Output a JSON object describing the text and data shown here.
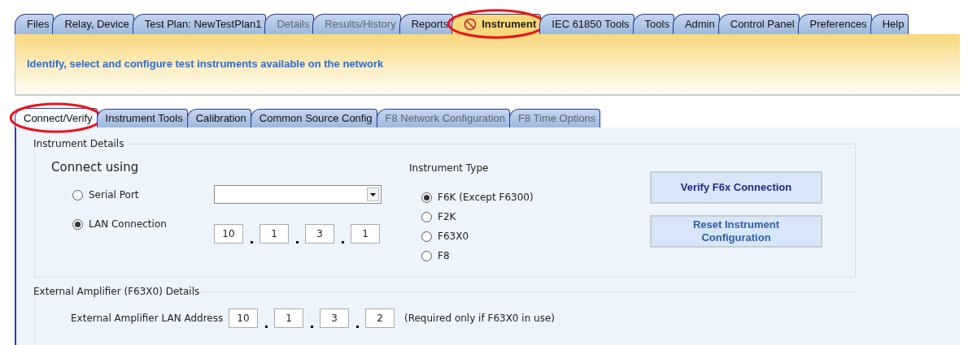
{
  "top_tabs": [
    {
      "label": "Files",
      "selected": false,
      "disabled": false,
      "circled": false,
      "blocked": false
    },
    {
      "label": "Relay, Device",
      "selected": false,
      "disabled": false,
      "circled": false,
      "blocked": false
    },
    {
      "label": "Test Plan: NewTestPlan1",
      "selected": false,
      "disabled": false,
      "circled": false,
      "blocked": false
    },
    {
      "label": "Details",
      "selected": false,
      "disabled": true,
      "circled": false,
      "blocked": false
    },
    {
      "label": "Results/History",
      "selected": false,
      "disabled": true,
      "circled": false,
      "blocked": false
    },
    {
      "label": "Reports",
      "selected": false,
      "disabled": false,
      "circled": false,
      "blocked": false
    },
    {
      "label": "Instrument",
      "selected": true,
      "disabled": false,
      "circled": true,
      "blocked": true
    },
    {
      "label": "IEC 61850 Tools",
      "selected": false,
      "disabled": false,
      "circled": false,
      "blocked": false
    },
    {
      "label": "Tools",
      "selected": false,
      "disabled": false,
      "circled": false,
      "blocked": false
    },
    {
      "label": "Admin",
      "selected": false,
      "disabled": false,
      "circled": false,
      "blocked": false
    },
    {
      "label": "Control Panel",
      "selected": false,
      "disabled": false,
      "circled": false,
      "blocked": false
    },
    {
      "label": "Preferences",
      "selected": false,
      "disabled": false,
      "circled": false,
      "blocked": false
    },
    {
      "label": "Help",
      "selected": false,
      "disabled": false,
      "circled": false,
      "blocked": false
    }
  ],
  "banner": {
    "text": "Identify, select and configure test instruments available on the network"
  },
  "sub_tabs": [
    {
      "label": "Connect/Verify",
      "selected": true,
      "disabled": false,
      "circled": true
    },
    {
      "label": "Instrument Tools",
      "selected": false,
      "disabled": false,
      "circled": false
    },
    {
      "label": "Calibration",
      "selected": false,
      "disabled": false,
      "circled": false
    },
    {
      "label": "Common Source Config",
      "selected": false,
      "disabled": false,
      "circled": false
    },
    {
      "label": "F8 Network Configuration",
      "selected": false,
      "disabled": true,
      "circled": false
    },
    {
      "label": "F8 Time Options",
      "selected": false,
      "disabled": true,
      "circled": false
    }
  ],
  "instrument_details": {
    "legend": "Instrument Details",
    "connect_label": "Connect using",
    "connection_options": [
      {
        "label": "Serial Port",
        "selected": false,
        "kind": "dropdown"
      },
      {
        "label": "LAN Connection",
        "selected": true,
        "kind": "ip",
        "octets": [
          "10",
          "1",
          "3",
          "1"
        ]
      }
    ],
    "instrument_type": {
      "label": "Instrument Type",
      "options": [
        {
          "label": "F6K (Except F6300)",
          "selected": true
        },
        {
          "label": "F2K",
          "selected": false
        },
        {
          "label": "F63X0",
          "selected": false
        },
        {
          "label": "F8",
          "selected": false
        }
      ]
    },
    "buttons": [
      {
        "label": "Verify F6x Connection",
        "kind": "primary"
      },
      {
        "label": "Reset Instrument Configuration",
        "kind": "secondary"
      }
    ]
  },
  "external_amplifier": {
    "legend": "External Amplifier (F63X0) Details",
    "label": "External Amplifier LAN Address",
    "octets": [
      "10",
      "1",
      "3",
      "2"
    ],
    "note": "(Required only if F63X0 in use)"
  }
}
